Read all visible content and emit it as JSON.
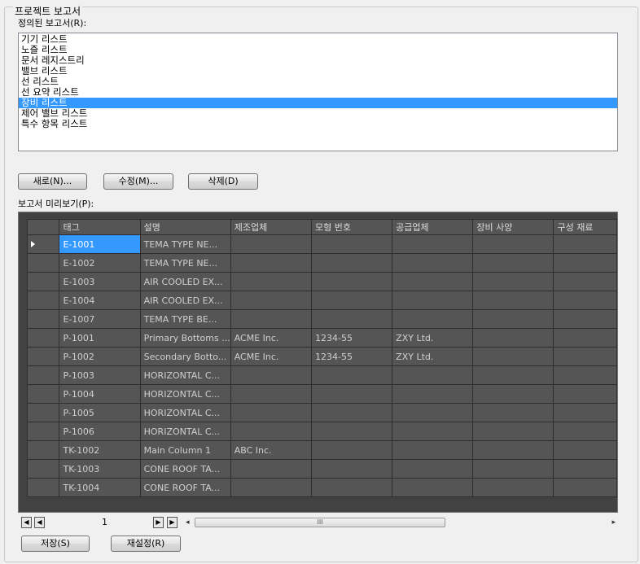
{
  "group_title": "프로젝트 보고서",
  "defined_label": "정의된 보고서(R):",
  "reports": [
    "기기 리스트",
    "노즐 리스트",
    "문서 레지스트리",
    "밸브 리스트",
    "선 리스트",
    "선 요약 리스트",
    "장비 리스트",
    "제어 밸브 리스트",
    "특수 항목 리스트"
  ],
  "selected_report_index": 6,
  "buttons": {
    "new": "새로(N)...",
    "edit": "수정(M)...",
    "delete": "삭제(D)",
    "save": "저장(S)",
    "reset": "재설정(R)"
  },
  "preview_label": "보고서 미리보기(P):",
  "columns": [
    "태그",
    "설명",
    "제조업체",
    "모형 번호",
    "공급업체",
    "장비 사양",
    "구성 재료"
  ],
  "rows": [
    [
      "E-1001",
      "TEMA TYPE NE...",
      "",
      "",
      "",
      "",
      ""
    ],
    [
      "E-1002",
      "TEMA TYPE NE...",
      "",
      "",
      "",
      "",
      ""
    ],
    [
      "E-1003",
      "AIR COOLED EX...",
      "",
      "",
      "",
      "",
      ""
    ],
    [
      "E-1004",
      "AIR COOLED EX...",
      "",
      "",
      "",
      "",
      ""
    ],
    [
      "E-1007",
      "TEMA TYPE BE...",
      "",
      "",
      "",
      "",
      ""
    ],
    [
      "P-1001",
      "Primary Bottoms ...",
      "ACME Inc.",
      "1234-55",
      "ZXY Ltd.",
      "",
      ""
    ],
    [
      "P-1002",
      "Secondary Botto...",
      "ACME Inc.",
      "1234-55",
      "ZXY Ltd.",
      "",
      ""
    ],
    [
      "P-1003",
      "HORIZONTAL C...",
      "",
      "",
      "",
      "",
      ""
    ],
    [
      "P-1004",
      "HORIZONTAL C...",
      "",
      "",
      "",
      "",
      ""
    ],
    [
      "P-1005",
      "HORIZONTAL C...",
      "",
      "",
      "",
      "",
      ""
    ],
    [
      "P-1006",
      "HORIZONTAL C...",
      "",
      "",
      "",
      "",
      ""
    ],
    [
      "TK-1002",
      "Main Column 1",
      "ABC Inc.",
      "",
      "",
      "",
      ""
    ],
    [
      "TK-1003",
      "CONE ROOF TA...",
      "",
      "",
      "",
      "",
      ""
    ],
    [
      "TK-1004",
      "CONE ROOF TA...",
      "",
      "",
      "",
      "",
      ""
    ]
  ],
  "current_row": 0,
  "page_number": "1",
  "scroll_grip": "III",
  "colors": {
    "selection": "#3399ff",
    "grid_bg": "#424242",
    "cell_bg": "#555555"
  }
}
